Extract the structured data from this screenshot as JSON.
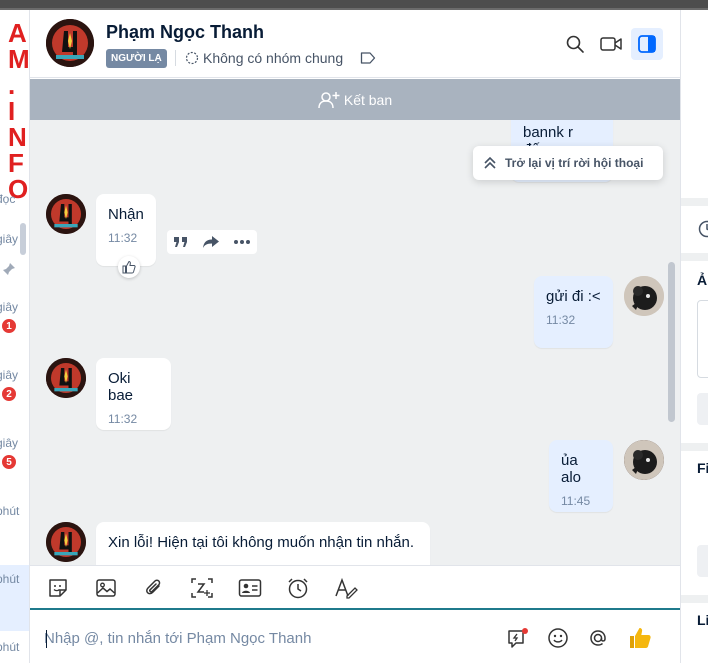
{
  "watermark": "AM.INFO",
  "left_strip": {
    "items": [
      {
        "label": "đọc"
      },
      {
        "label": "giây",
        "badge": ""
      },
      {
        "label": "giây",
        "badge": "1"
      },
      {
        "label": "giây",
        "badge": "2"
      },
      {
        "label": "giây",
        "badge": "5"
      },
      {
        "label": "phút",
        "badge": ""
      },
      {
        "label": "phút",
        "badge": ""
      },
      {
        "label": "phút",
        "badge": ""
      }
    ]
  },
  "header": {
    "contact_name": "Phạm Ngọc Thanh",
    "stranger_tag": "NGƯỜI LẠ",
    "group_info": "Không có nhóm chung",
    "icons": [
      "search-icon",
      "video-call-icon",
      "conversation-info-icon"
    ]
  },
  "add_friend": {
    "label": "Kết ban"
  },
  "scroll_back": {
    "label": "Trở lại vị trí rời hội thoại"
  },
  "messages": [
    {
      "direction": "out",
      "text": "bannk r đấy",
      "time": ""
    },
    {
      "direction": "in",
      "text": "Nhận",
      "time": "11:32"
    },
    {
      "direction": "out",
      "text": "gửi đi :<",
      "time": "11:32"
    },
    {
      "direction": "in",
      "text": "Oki bae",
      "time": "11:32"
    },
    {
      "direction": "out",
      "text": "ủa alo",
      "time": "11:45"
    },
    {
      "direction": "in",
      "text": "Xin lỗi! Hiện tại tôi không muốn nhận tin nhắn.",
      "time": ""
    }
  ],
  "toolbar": {
    "icons": [
      "sticker-icon",
      "image-icon",
      "attachment-icon",
      "screenshot-icon",
      "contact-card-icon",
      "reminder-clock-icon",
      "text-format-icon"
    ]
  },
  "composer": {
    "placeholder": "Nhập @, tin nhắn tới Phạm Ngọc Thanh",
    "value": ""
  },
  "right_panel": {
    "labels": [
      "Ả",
      "Fi",
      "Li"
    ]
  },
  "colors": {
    "accent": "#0068ff",
    "outgoing_bubble": "#e5efff",
    "chat_background": "#eef0f1",
    "add_friend_bar": "#a9b3bf",
    "badge": "#e53935",
    "like": "#f5b70f"
  }
}
